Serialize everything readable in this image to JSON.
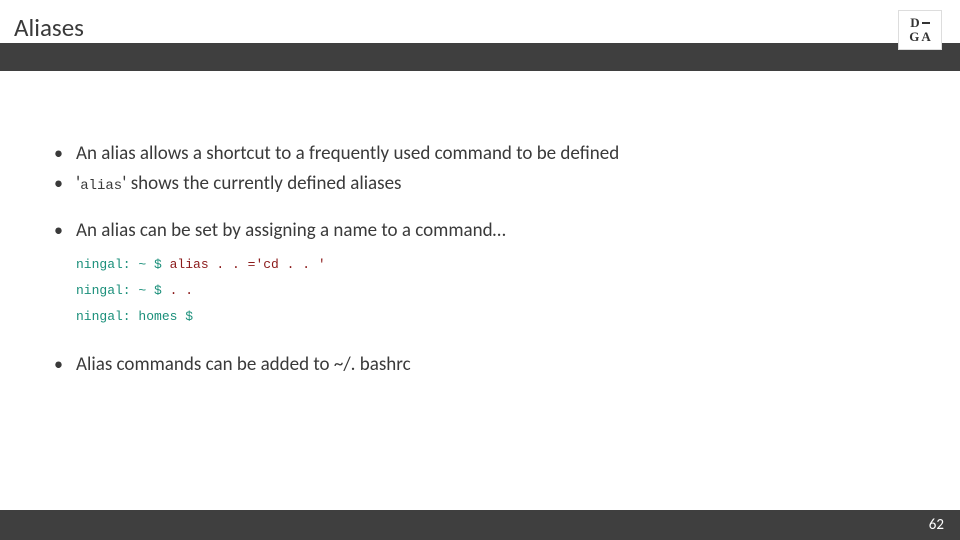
{
  "slide": {
    "title": "Aliases",
    "page_number": "62"
  },
  "logo": {
    "row1_left": "D",
    "row2_left": "G",
    "row2_right": "A"
  },
  "bullets": {
    "b1": "An alias allows a shortcut to a frequently used command to be defined",
    "b2_pre": "'",
    "b2_code": "alias",
    "b2_post": "' shows the currently defined aliases",
    "b3": "An alias can be set by assigning a name to a command…",
    "b4": "Alias commands can be added to ~/. bashrc"
  },
  "terminal": {
    "line1_prompt": "ningal: ~ $ ",
    "line1_cmd": "alias . . ='cd . . '",
    "line2_prompt": "ningal: ~ $ ",
    "line2_cmd": ". .",
    "line3_prompt": "ningal: homes $",
    "line3_cmd": ""
  }
}
